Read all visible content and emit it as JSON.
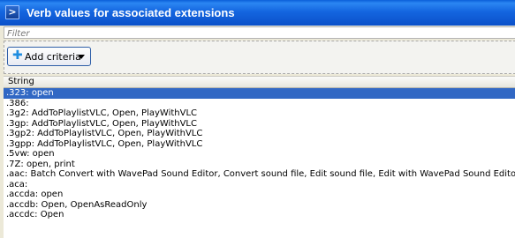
{
  "window": {
    "title": "Verb values for associated extensions",
    "icon": "powershell-icon"
  },
  "filter": {
    "placeholder": "Filter",
    "value": ""
  },
  "toolbar": {
    "add_criteria_label": "Add criteria",
    "add_icon": "plus-icon",
    "arrow_icon": "dropdown-arrow-icon"
  },
  "list": {
    "column_header": "String",
    "selected_index": 0,
    "rows": [
      ".323: open",
      ".386:",
      ".3g2: AddToPlaylistVLC, Open, PlayWithVLC",
      ".3gp: AddToPlaylistVLC, Open, PlayWithVLC",
      ".3gp2: AddToPlaylistVLC, Open, PlayWithVLC",
      ".3gpp: AddToPlaylistVLC, Open, PlayWithVLC",
      ".5vw: open",
      ".7Z: open, print",
      ".aac: Batch Convert with WavePad Sound Editor, Convert sound file, Edit sound file, Edit with WavePad Sound Editor",
      ".aca:",
      ".accda: open",
      ".accdb: Open, OpenAsReadOnly",
      ".accdc: Open"
    ]
  },
  "colors": {
    "titlebar": "#0b50c9",
    "selection": "#3168c4",
    "accent": "#1f8de0"
  }
}
